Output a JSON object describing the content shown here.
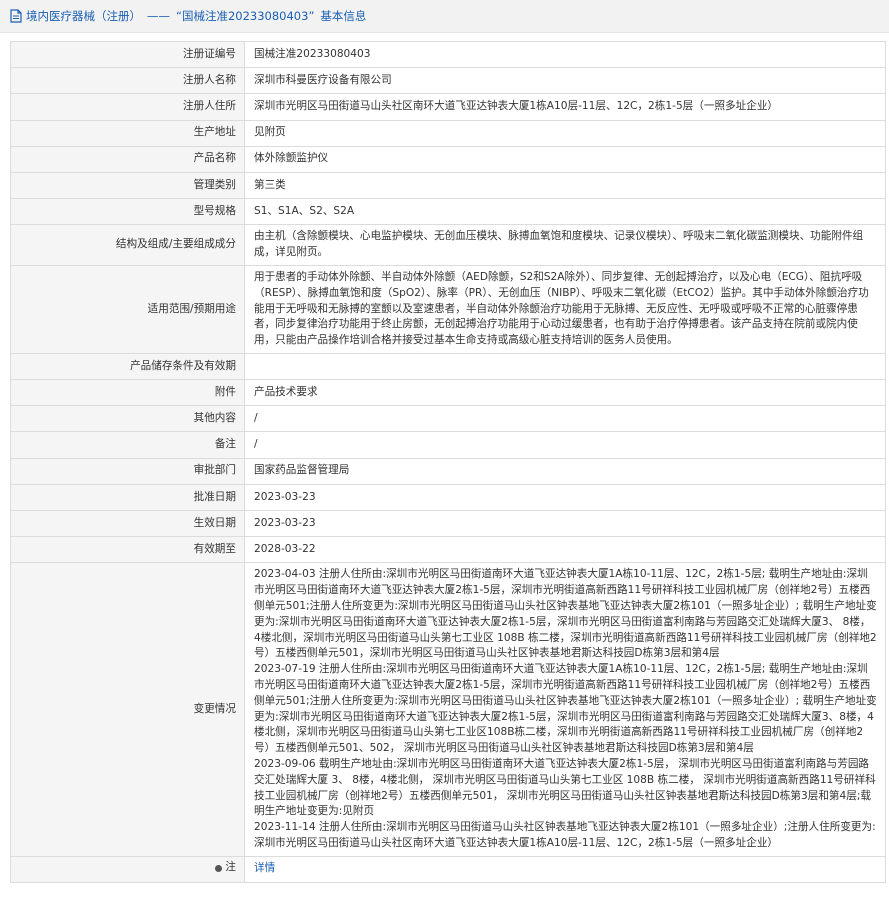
{
  "breadcrumb": {
    "section": "境内医疗器械（注册）",
    "separator": "——",
    "title": "“国械注准20233080403”",
    "suffix": "基本信息"
  },
  "rows": [
    {
      "label": "注册证编号",
      "value": "国械注准20233080403"
    },
    {
      "label": "注册人名称",
      "value": "深圳市科曼医疗设备有限公司"
    },
    {
      "label": "注册人住所",
      "value": "深圳市光明区马田街道马山头社区南环大道飞亚达钟表大厦1栋A10层-11层、12C，2栋1-5层（一照多址企业）"
    },
    {
      "label": "生产地址",
      "value": "见附页"
    },
    {
      "label": "产品名称",
      "value": "体外除颤监护仪"
    },
    {
      "label": "管理类别",
      "value": "第三类"
    },
    {
      "label": "型号规格",
      "value": "S1、S1A、S2、S2A"
    },
    {
      "label": "结构及组成/主要组成成分",
      "value": "由主机（含除颤模块、心电监护模块、无创血压模块、脉搏血氧饱和度模块、记录仪模块）、呼吸末二氧化碳监测模块、功能附件组成，详见附页。"
    },
    {
      "label": "适用范围/预期用途",
      "value": "用于患者的手动体外除颤、半自动体外除颤（AED除颤，S2和S2A除外）、同步复律、无创起搏治疗，以及心电（ECG）、阻抗呼吸（RESP）、脉搏血氧饱和度（SpO2）、脉率（PR）、无创血压（NIBP）、呼吸末二氧化碳（EtCO2）监护。其中手动体外除颤治疗功能用于无呼吸和无脉搏的室颤以及室速患者，半自动体外除颤治疗功能用于无脉搏、无反应性、无呼吸或呼吸不正常的心脏骤停患者，同步复律治疗功能用于终止房颤，无创起搏治疗功能用于心动过缓患者，也有助于治疗停搏患者。该产品支持在院前或院内使用，只能由产品操作培训合格并接受过基本生命支持或高级心脏支持培训的医务人员使用。"
    },
    {
      "label": "产品储存条件及有效期",
      "value": ""
    },
    {
      "label": "附件",
      "value": "产品技术要求"
    },
    {
      "label": "其他内容",
      "value": "/"
    },
    {
      "label": "备注",
      "value": "/"
    },
    {
      "label": "审批部门",
      "value": "国家药品监督管理局"
    },
    {
      "label": "批准日期",
      "value": "2023-03-23"
    },
    {
      "label": "生效日期",
      "value": "2023-03-23"
    },
    {
      "label": "有效期至",
      "value": "2028-03-22"
    }
  ],
  "changes": {
    "label": "变更情况",
    "entries": [
      "2023-04-03 注册人住所由:深圳市光明区马田街道南环大道飞亚达钟表大厦1A栋10-11层、12C，2栋1-5层; 载明生产地址由:深圳市光明区马田街道南环大道飞亚达钟表大厦2栋1-5层，深圳市光明街道高新西路11号研祥科技工业园机械厂房（创祥地2号）五楼西侧单元501;注册人住所变更为:深圳市光明区马田街道马山头社区钟表基地飞亚达钟表大厦2栋101（一照多址企业）; 载明生产地址变更为:深圳市光明区马田街道南环大道飞亚达钟表大厦2栋1-5层，深圳市光明区马田街道富利南路与芳园路交汇处瑞辉大厦3、 8楼，4楼北侧，深圳市光明区马田街道马山头第七工业区 108B 栋二楼，深圳市光明街道高新西路11号研祥科技工业园机械厂房（创祥地2号）五楼西侧单元501，深圳市光明区马田街道马山头社区钟表基地君斯达科技园D栋第3层和第4层",
      "2023-07-19 注册人住所由:深圳市光明区马田街道南环大道飞亚达钟表大厦1A栋10-11层、12C，2栋1-5层; 载明生产地址由:深圳市光明区马田街道南环大道飞亚达钟表大厦2栋1-5层，深圳市光明街道高新西路11号研祥科技工业园机械厂房（创祥地2号）五楼西侧单元501;注册人住所变更为:深圳市光明区马田街道马山头社区钟表基地飞亚达钟表大厦2栋101（一照多址企业）; 载明生产地址变更为:深圳市光明区马田街道南环大道飞亚达钟表大厦2栋1-5层，深圳市光明区马田街道富利南路与芳园路交汇处瑞辉大厦3、8楼，4楼北侧，深圳市光明区马田街道马山头第七工业区108B栋二楼，深圳市光明街道高新西路11号研祥科技工业园机械厂房（创祥地2号）五楼西侧单元501、502， 深圳市光明区马田街道马山头社区钟表基地君斯达科技园D栋第3层和第4层",
      "2023-09-06 载明生产地址由:深圳市光明区马田街道南环大道飞亚达钟表大厦2栋1-5层， 深圳市光明区马田街道富利南路与芳园路交汇处瑞辉大厦 3、 8楼，4楼北侧， 深圳市光明区马田街道马山头第七工业区 108B 栋二楼， 深圳市光明街道高新西路11号研祥科技工业园机械厂房（创祥地2号）五楼西侧单元501， 深圳市光明区马田街道马山头社区钟表基地君斯达科技园D栋第3层和第4层;载明生产地址变更为:见附页",
      "2023-11-14 注册人住所由:深圳市光明区马田街道马山头社区钟表基地飞亚达钟表大厦2栋101（一照多址企业）;注册人住所变更为:深圳市光明区马田街道马山头社区南环大道飞亚达钟表大厦1栋A10层-11层、12C，2栋1-5层（一照多址企业）"
    ]
  },
  "note": {
    "label": "注",
    "link_text": "详情"
  },
  "colors": {
    "link": "#1a5fb4",
    "label_bg": "#f5f5f5",
    "border": "#dcdcdc"
  }
}
